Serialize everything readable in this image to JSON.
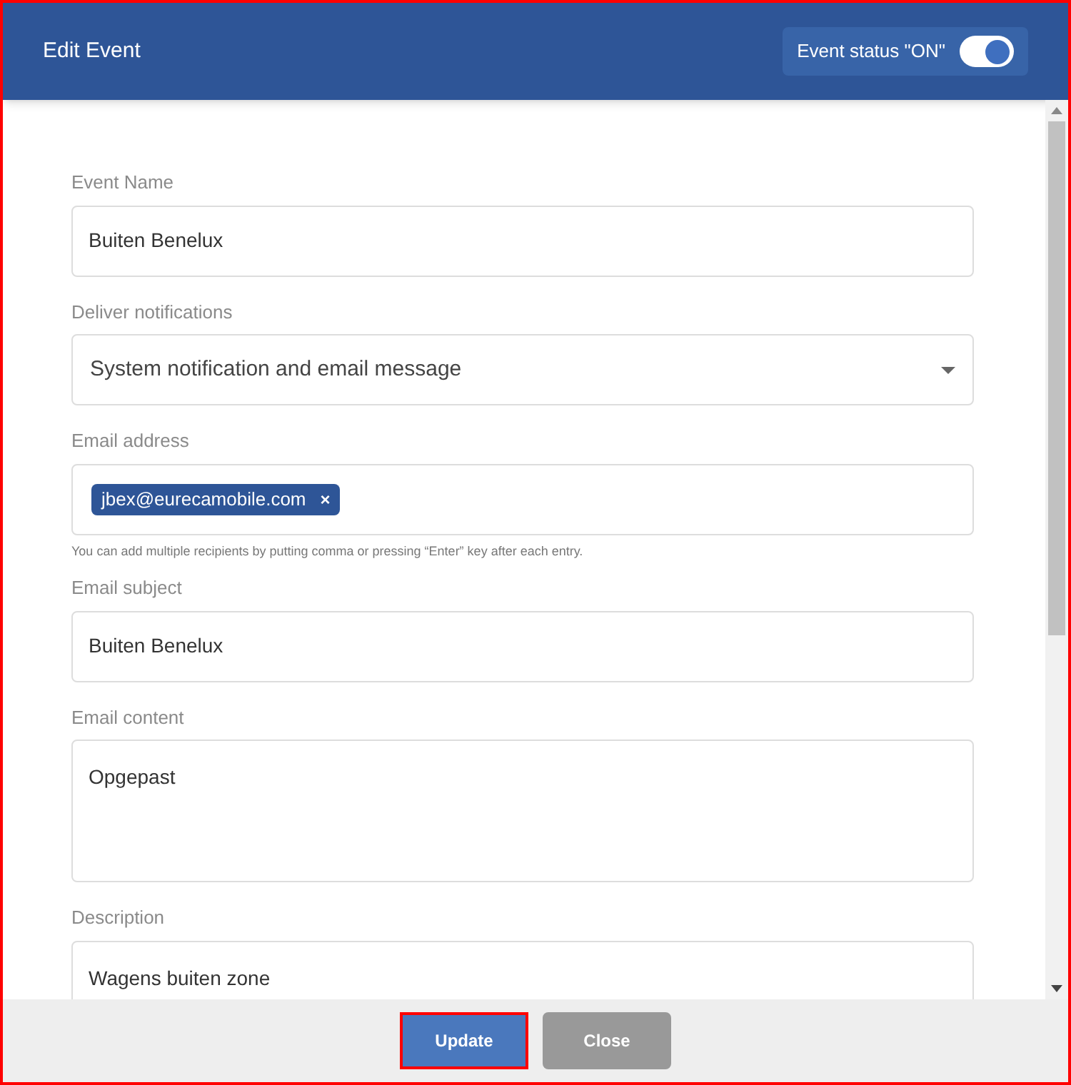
{
  "header": {
    "title": "Edit Event",
    "status_label": "Event status \"ON\"",
    "status_on": true
  },
  "fields": [
    {
      "kind": "text",
      "label": "Event Name",
      "value": "Buiten Benelux"
    },
    {
      "kind": "select",
      "label": "Deliver notifications",
      "value": "System notification and email message"
    },
    {
      "kind": "tags",
      "label": "Email address",
      "tags": [
        "jbex@eurecamobile.com"
      ],
      "remove": "×",
      "hint": "You can add multiple recipients by putting comma or pressing “Enter” key after each entry."
    },
    {
      "kind": "text",
      "label": "Email subject",
      "value": "Buiten Benelux"
    },
    {
      "kind": "textarea",
      "label": "Email content",
      "value": "Opgepast"
    },
    {
      "kind": "textarea",
      "label": "Description",
      "value": "Wagens buiten zone"
    }
  ],
  "buttons": [
    {
      "label": "Update",
      "kind": "primary",
      "highlighted": true
    },
    {
      "label": "Close",
      "kind": "secondary",
      "highlighted": false
    }
  ]
}
